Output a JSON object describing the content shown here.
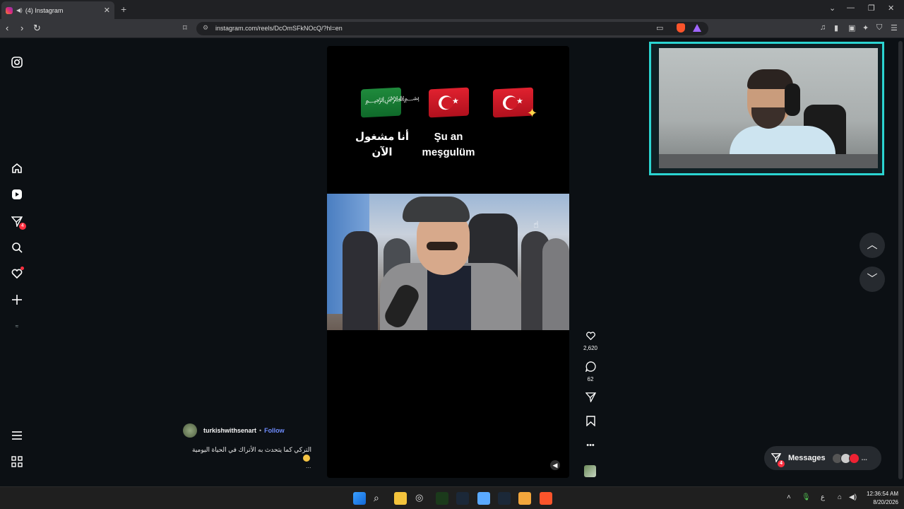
{
  "browser": {
    "tab_title": "(4) Instagram",
    "new_tab": "+",
    "url": "instagram.com/reels/DcOmSFkNOcQ/?hl=en"
  },
  "sidebar": {
    "instagram_logo": "instagram-icon",
    "items": [
      {
        "name": "home",
        "icon": "home-icon"
      },
      {
        "name": "reels",
        "icon": "reels-icon"
      },
      {
        "name": "direct",
        "icon": "send-icon",
        "badge": "4"
      },
      {
        "name": "search",
        "icon": "search-icon"
      },
      {
        "name": "notifications",
        "icon": "heart-icon"
      },
      {
        "name": "create",
        "icon": "plus-icon"
      },
      {
        "name": "profile",
        "icon": "avatar"
      }
    ],
    "more": "menu-icon",
    "also_from_meta": "grid-icon"
  },
  "reel": {
    "caption_ar_line1": "أنا مشغول",
    "caption_ar_line2": "الآن",
    "caption_tr_line1": "Şu an",
    "caption_tr_line2": "meşgulüm",
    "author": "turkishwithsenart",
    "separator": "•",
    "follow": "Follow",
    "description": "التركي كما يتحدث به الأتراك في الحياة اليومية",
    "more": "...",
    "likes": "2,620",
    "comments": "62"
  },
  "messages": {
    "label": "Messages",
    "badge": "4",
    "more": "..."
  },
  "taskbar": {
    "time": "12:36:54 AM",
    "date": "8/20/2026",
    "lang": "ع"
  }
}
